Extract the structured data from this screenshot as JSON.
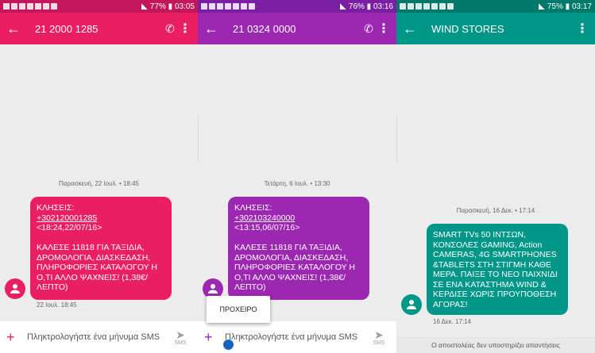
{
  "screens": [
    {
      "status": {
        "right": "77% ▮ 03:05"
      },
      "title": "21 2000 1285",
      "date": "Παρασκευή, 22 Ιουλ. • 18:45",
      "message": {
        "prefix": "ΚΛΗΣΕΙΣ:",
        "number": "+302120001285",
        "rest": "<18:24,22/07/16>\n\nΚΑΛΕΣΕ 11818 ΓΙΑ ΤΑΞΙΔΙΑ, ΔΡΟΜΟΛΟΓΙΑ, ΔΙΑΣΚΕΔΑΣΗ, ΠΛΗΡΟΦΟΡΙΕΣ ΚΑΤΑΛΟΓΟΥ Η Ο,ΤΙ ΑΛΛΟ ΨΑΧΝΕΙΣ! (1,38€/ΛΕΠΤΟ)"
      },
      "time": "22 Ιουλ. 18:45",
      "composer_placeholder": "Πληκτρολογήστε ένα μήνυμα SMS",
      "send_label": "SMS"
    },
    {
      "status": {
        "right": "76% ▮ 03:16"
      },
      "title": "21 0324 0000",
      "date": "Τετάρτη, 6 Ιουλ. • 13:30",
      "message": {
        "prefix": "ΚΛΗΣΕΙΣ:",
        "number": "+302103240000",
        "rest": "<13:15,06/07/16>\n\nΚΑΛΕΣΕ 11818 ΓΙΑ ΤΑΞΙΔΙΑ, ΔΡΟΜΟΛΟΓΙΑ, ΔΙΑΣΚΕΔΑΣΗ, ΠΛΗΡΟΦΟΡΙΕΣ ΚΑΤΑΛΟΓΟΥ Η Ο,ΤΙ ΑΛΛΟ ΨΑΧΝΕΙΣ! (1,38€/ΛΕΠΤΟ)"
      },
      "popup": "ΠΡΟΧΕΙΡΟ",
      "composer_placeholder": "Πληκτρολογήστε ένα μήνυμα SMS",
      "send_label": "SMS"
    },
    {
      "status": {
        "right": "75% ▮ 03:17"
      },
      "title": "WIND STORES",
      "date": "Παρασκευή, 16 Δεκ. • 17:14",
      "message": {
        "body": "SMART TVs 50 ΙΝΤΣΩΝ, ΚΟΝΣΟΛΕΣ GAMING, Action CAMERAS, 4G SMARTPHONES &TABLETS ΣΤΗ ΣΤΙΓΜΗ ΚΑΘΕ ΜΕΡΑ. ΠΑΙΞΕ ΤΟ ΝΕΟ ΠΑΙΧΝΙΔΙ ΣΕ ΕΝΑ ΚΑΤΑΣΤΗΜΑ WIND & ΚΕΡΔΙΣΕ ΧΩΡΙΣ ΠΡΟΥΠΟΘΕΣΗ ΑΓΟΡΑΣ!"
      },
      "time": "16 Δεκ. 17:14",
      "noreply": "Ο αποστολέας δεν υποστηρίζει απαντήσεις"
    }
  ],
  "icons": [
    "back-arrow-icon",
    "phone-icon",
    "more-vert-icon",
    "person-icon",
    "add-icon",
    "send-icon"
  ],
  "colors": {
    "pink": "#e91e63",
    "purple": "#9c27b0",
    "teal": "#009688"
  }
}
